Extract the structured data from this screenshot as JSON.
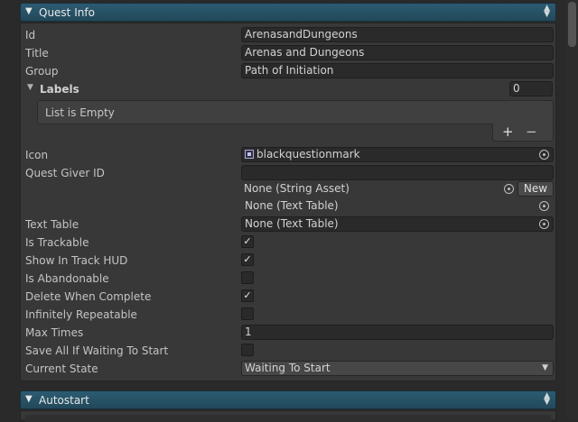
{
  "quest_info": {
    "title": "Quest Info",
    "fields": {
      "id": {
        "label": "Id",
        "value": "ArenasandDungeons"
      },
      "title": {
        "label": "Title",
        "value": "Arenas and Dungeons"
      },
      "group": {
        "label": "Group",
        "value": "Path of Initiation"
      }
    },
    "labels": {
      "label": "Labels",
      "count": "0",
      "empty_text": "List is Empty",
      "add": "+",
      "remove": "−"
    },
    "icon": {
      "label": "Icon",
      "value": "blackquestionmark"
    },
    "quest_giver": {
      "label": "Quest Giver ID",
      "value": "",
      "string_asset": "None (String Asset)",
      "new_button": "New",
      "text_table": "None (Text Table)"
    },
    "text_table": {
      "label": "Text Table",
      "value": "None (Text Table)"
    },
    "toggles": [
      {
        "label": "Is Trackable",
        "checked": true
      },
      {
        "label": "Show In Track HUD",
        "checked": true
      },
      {
        "label": "Is Abandonable",
        "checked": false
      },
      {
        "label": "Delete When Complete",
        "checked": true
      },
      {
        "label": "Infinitely Repeatable",
        "checked": false
      }
    ],
    "max_times": {
      "label": "Max Times",
      "value": "1"
    },
    "save_all": {
      "label": "Save All If Waiting To Start",
      "checked": false
    },
    "current_state": {
      "label": "Current State",
      "value": "Waiting To Start"
    }
  },
  "autostart": {
    "title": "Autostart"
  },
  "glyphs": {
    "expanded": "▼",
    "check": "✓",
    "dropdown": "▼",
    "spinner": "▲▼"
  },
  "colors": {
    "header": "#2c5c72",
    "field": "#2a2a2a",
    "panel": "#383838"
  }
}
